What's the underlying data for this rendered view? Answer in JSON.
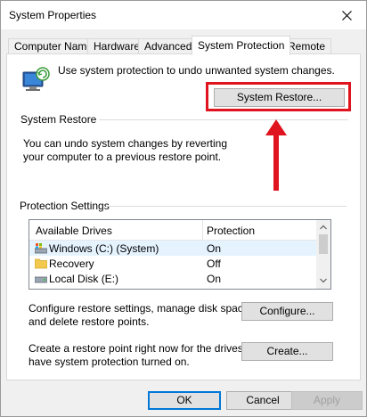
{
  "window": {
    "title": "System Properties"
  },
  "tabs": [
    "Computer Name",
    "Hardware",
    "Advanced",
    "System Protection",
    "Remote"
  ],
  "active_tab": "System Protection",
  "info_text": "Use system protection to undo unwanted system changes.",
  "system_restore": {
    "group_label": "System Restore",
    "desc_line1": "You can undo system changes by reverting",
    "desc_line2": "your computer to a previous restore point.",
    "button_label": "System Restore..."
  },
  "protection": {
    "group_label": "Protection Settings",
    "columns": [
      "Available Drives",
      "Protection"
    ],
    "drives": [
      {
        "name": "Windows (C:) (System)",
        "protection": "On",
        "icon": "system-drive-icon",
        "selected": true
      },
      {
        "name": "Recovery",
        "protection": "Off",
        "icon": "folder-icon",
        "selected": false
      },
      {
        "name": "Local Disk (E:)",
        "protection": "On",
        "icon": "disk-drive-icon",
        "selected": false
      }
    ],
    "configure_desc_line1": "Configure restore settings, manage disk space,",
    "configure_desc_line2": "and delete restore points.",
    "configure_label": "Configure...",
    "create_desc_line1": "Create a restore point right now for the drives that",
    "create_desc_line2": "have system protection turned on.",
    "create_label": "Create..."
  },
  "footer": {
    "ok": "OK",
    "cancel": "Cancel",
    "apply": "Apply"
  },
  "colors": {
    "highlight": "#e0141e",
    "accent": "#0078d7"
  }
}
